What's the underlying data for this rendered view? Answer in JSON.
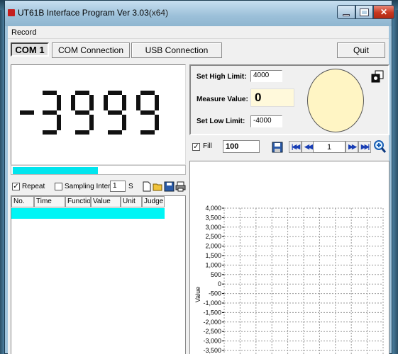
{
  "window": {
    "title": "UT61B Interface Program Ver 3.03",
    "title_suffix": "(x64)"
  },
  "menu": {
    "record": "Record"
  },
  "toolbar": {
    "com_label": "COM 1",
    "com_connection": "COM Connection",
    "usb_connection": "USB Connection",
    "quit": "Quit"
  },
  "reading": {
    "value": "-3999"
  },
  "bargraph": {
    "lit_segments": 24,
    "total_segments": 40
  },
  "limits": {
    "high_label": "Set High Limit:",
    "high_value": "4000",
    "measure_label": "Measure Value:",
    "measure_value": "0",
    "low_label": "Set Low Limit:",
    "low_value": "-4000"
  },
  "chart_controls": {
    "fill_label": "Fill",
    "fill_checked": true,
    "fill_value": "100",
    "page_value": "1"
  },
  "sampling": {
    "repeat_label": "Repeat",
    "repeat_checked": true,
    "interval_label": "Sampling Interval",
    "interval_value": "1",
    "unit": "S"
  },
  "table": {
    "columns": [
      "No.",
      "Time",
      "Function",
      "Value",
      "Unit",
      "Judge"
    ]
  },
  "colors": {
    "accent_cyan": "#00f5f5",
    "led_fill": "#fff5c4",
    "nav_blue": "#1a3fb5"
  },
  "chart_data": {
    "type": "line",
    "ylabel": "Value",
    "ylim": [
      -3999,
      4000
    ],
    "yticks": [
      "4,000",
      "3,500",
      "3,000",
      "2,500",
      "2,000",
      "1,500",
      "1,000",
      "500",
      "0",
      "-500",
      "-1,000",
      "-1,500",
      "-2,000",
      "-2,500",
      "-3,000",
      "-3,500"
    ],
    "grid": true,
    "series": []
  }
}
